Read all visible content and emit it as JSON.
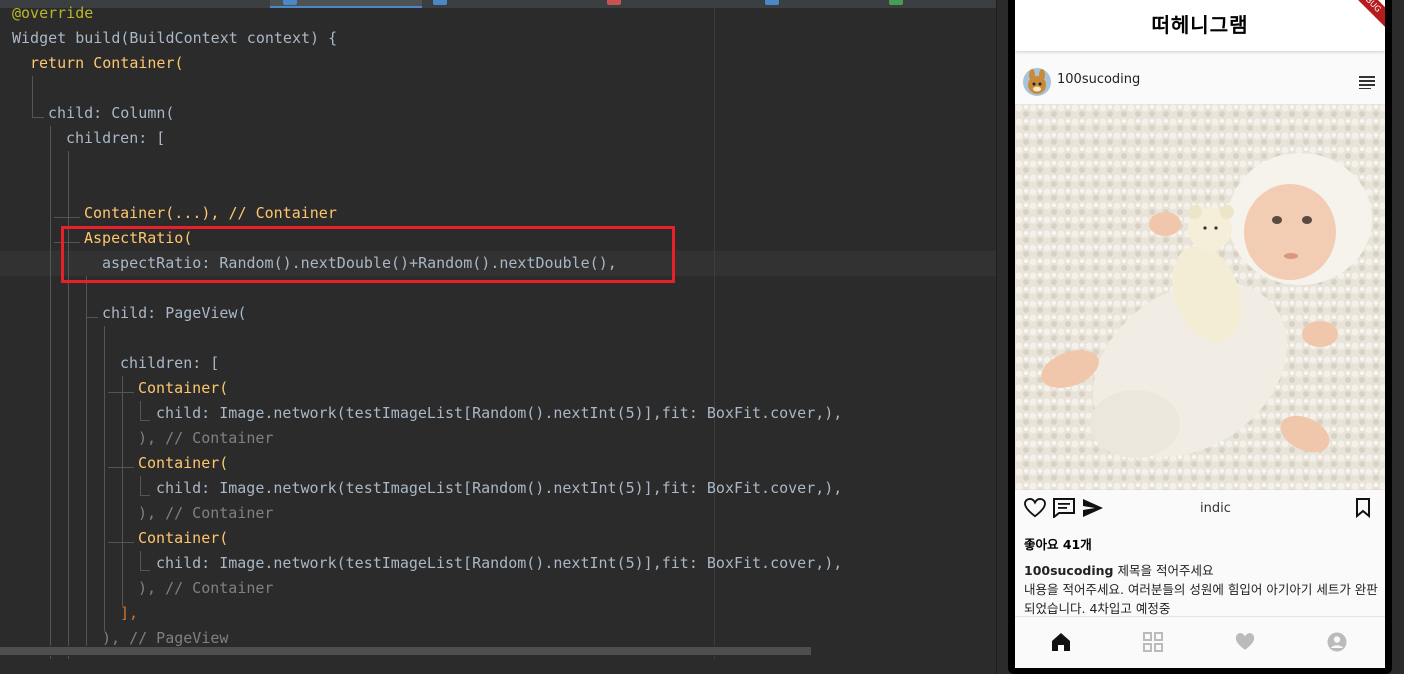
{
  "editor": {
    "lines": [
      "@override",
      "Widget build(BuildContext context) {",
      "return Container(",
      "child: Column(",
      "children: [",
      "Container(...), // Container",
      "AspectRatio(",
      "aspectRatio: Random().nextDouble()+Random().nextDouble(),",
      "child: PageView(",
      "children: [",
      "Container(",
      "child: Image.network(testImageList[Random().nextInt(5)],fit: BoxFit.cover,),",
      "), // Container",
      "],",
      "), // PageView"
    ]
  },
  "app": {
    "title": "떠헤니그램",
    "debug_label": "DEBUG",
    "username": "100sucoding",
    "caption_overlay": "indic",
    "likes": "좋아요 41개",
    "post_title": "제목을 적어주세요",
    "body_text": "내용을 적어주세요. 여러분들의 성원에 힘입어 아기아기 세트가 완판되었습니다. 4차입고 예정중"
  },
  "icons": {
    "menu": "menu-lines-icon",
    "like": "heart-outline-icon",
    "comment": "comment-icon",
    "share": "send-icon",
    "bookmark": "bookmark-icon",
    "nav": [
      "home-icon",
      "grid-icon",
      "heart-icon",
      "account-icon"
    ]
  },
  "colors": {
    "highlight_box": "#e8202a",
    "keyword": "#cc7832",
    "function": "#ffc66d",
    "comment": "#808080"
  }
}
